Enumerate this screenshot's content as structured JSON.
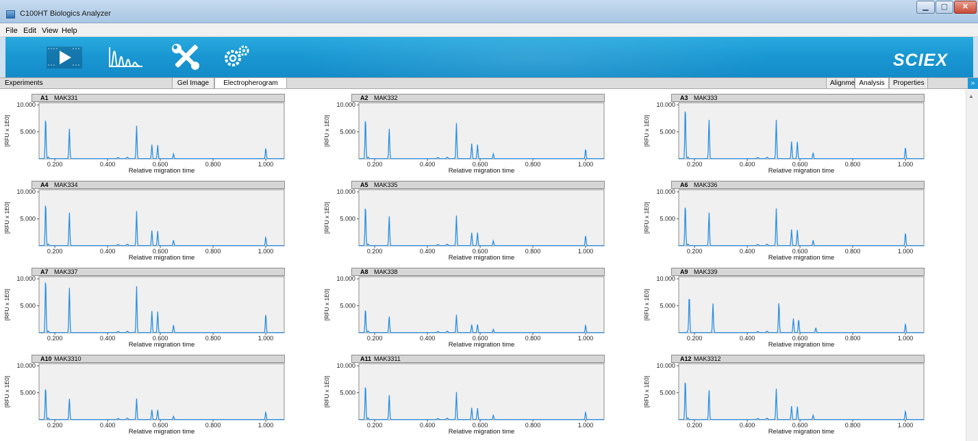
{
  "app": {
    "title": "C100HT Biologics Analyzer"
  },
  "window_controls": {
    "minimize": "▁",
    "maximize": "▢",
    "close": "✕"
  },
  "menu": [
    "File",
    "Edit",
    "View",
    "Help"
  ],
  "toolbar": {
    "logo": "SCIEX",
    "icons": [
      "run-icon",
      "electropherogram-icon",
      "tools-icon",
      "settings-gears-icon"
    ]
  },
  "tabs": {
    "experiments": "Experiments",
    "gel_image": "Gel Image",
    "electropherogram": "Electropherogram",
    "alignment": "Alignment",
    "analysis": "Analysis",
    "properties": "Properties",
    "collapse_toggle": "»"
  },
  "colors": {
    "trace": "#2b8fe0",
    "plot_bg": "#f0f0f0",
    "toolbar": "#1a98d3"
  },
  "chart_data": {
    "type": "line",
    "xlabel": "Relative migration time",
    "ylabel": "[RFU x 1E0]",
    "xticks": [
      0.2,
      0.4,
      0.6,
      0.8,
      1.0
    ],
    "xtick_labels": [
      "0.200",
      "0.400",
      "0.600",
      "0.800",
      "1.000"
    ],
    "yticks": [
      5,
      10
    ],
    "ytick_labels": [
      "5.000",
      "10.000"
    ],
    "xlim": [
      0.14,
      1.07
    ],
    "ylim": [
      0,
      10.4
    ],
    "grid": false,
    "panels": [
      {
        "well": "A1",
        "sample": "MAK331",
        "peaks": [
          [
            0.165,
            7.8
          ],
          [
            0.255,
            5.6
          ],
          [
            0.51,
            6.1
          ],
          [
            0.568,
            2.6
          ],
          [
            0.59,
            2.5
          ],
          [
            0.65,
            0.9
          ],
          [
            1.0,
            2.0
          ]
        ]
      },
      {
        "well": "A2",
        "sample": "MAK332",
        "peaks": [
          [
            0.165,
            7.7
          ],
          [
            0.255,
            5.6
          ],
          [
            0.51,
            6.6
          ],
          [
            0.568,
            2.8
          ],
          [
            0.59,
            2.6
          ],
          [
            0.65,
            0.9
          ],
          [
            1.0,
            1.8
          ]
        ]
      },
      {
        "well": "A3",
        "sample": "MAK333",
        "peaks": [
          [
            0.165,
            9.7
          ],
          [
            0.255,
            7.3
          ],
          [
            0.51,
            7.2
          ],
          [
            0.568,
            3.2
          ],
          [
            0.59,
            3.1
          ],
          [
            0.65,
            1.1
          ],
          [
            1.0,
            2.1
          ]
        ]
      },
      {
        "well": "A4",
        "sample": "MAK334",
        "peaks": [
          [
            0.165,
            8.2
          ],
          [
            0.255,
            6.2
          ],
          [
            0.51,
            6.4
          ],
          [
            0.568,
            2.8
          ],
          [
            0.59,
            2.7
          ],
          [
            0.65,
            1.0
          ],
          [
            1.0,
            1.6
          ]
        ]
      },
      {
        "well": "A5",
        "sample": "MAK335",
        "peaks": [
          [
            0.165,
            7.6
          ],
          [
            0.255,
            5.5
          ],
          [
            0.51,
            5.6
          ],
          [
            0.568,
            2.4
          ],
          [
            0.59,
            2.4
          ],
          [
            0.65,
            0.9
          ],
          [
            1.0,
            1.9
          ]
        ]
      },
      {
        "well": "A6",
        "sample": "MAK336",
        "peaks": [
          [
            0.165,
            7.8
          ],
          [
            0.255,
            6.2
          ],
          [
            0.51,
            6.9
          ],
          [
            0.568,
            3.0
          ],
          [
            0.59,
            2.9
          ],
          [
            0.65,
            1.0
          ],
          [
            1.0,
            2.4
          ]
        ]
      },
      {
        "well": "A7",
        "sample": "MAK337",
        "peaks": [
          [
            0.165,
            10.3
          ],
          [
            0.255,
            8.4
          ],
          [
            0.51,
            8.6
          ],
          [
            0.568,
            4.0
          ],
          [
            0.59,
            3.9
          ],
          [
            0.65,
            1.4
          ],
          [
            1.0,
            3.5
          ]
        ]
      },
      {
        "well": "A8",
        "sample": "MAK338",
        "peaks": [
          [
            0.165,
            4.5
          ],
          [
            0.255,
            3.0
          ],
          [
            0.51,
            3.3
          ],
          [
            0.568,
            1.5
          ],
          [
            0.59,
            1.5
          ],
          [
            0.65,
            0.6
          ],
          [
            1.0,
            1.4
          ]
        ]
      },
      {
        "well": "A9",
        "sample": "MAK339",
        "peaks": [
          [
            0.18,
            7.0
          ],
          [
            0.27,
            5.4
          ],
          [
            0.52,
            5.7
          ],
          [
            0.575,
            2.6
          ],
          [
            0.595,
            2.5
          ],
          [
            0.66,
            0.9
          ],
          [
            1.0,
            1.6
          ]
        ]
      },
      {
        "well": "A10",
        "sample": "MAK3310",
        "peaks": [
          [
            0.165,
            6.2
          ],
          [
            0.255,
            3.9
          ],
          [
            0.51,
            3.9
          ],
          [
            0.568,
            1.8
          ],
          [
            0.59,
            1.8
          ],
          [
            0.65,
            0.6
          ],
          [
            1.0,
            1.4
          ]
        ]
      },
      {
        "well": "A11",
        "sample": "MAK3311",
        "peaks": [
          [
            0.165,
            6.6
          ],
          [
            0.255,
            4.6
          ],
          [
            0.51,
            5.1
          ],
          [
            0.568,
            2.2
          ],
          [
            0.59,
            2.1
          ],
          [
            0.65,
            0.8
          ],
          [
            1.0,
            1.4
          ]
        ]
      },
      {
        "well": "A12",
        "sample": "MAK3312",
        "peaks": [
          [
            0.165,
            7.6
          ],
          [
            0.255,
            5.5
          ],
          [
            0.51,
            5.7
          ],
          [
            0.568,
            2.5
          ],
          [
            0.59,
            2.4
          ],
          [
            0.65,
            0.8
          ],
          [
            1.0,
            1.6
          ]
        ]
      }
    ]
  }
}
